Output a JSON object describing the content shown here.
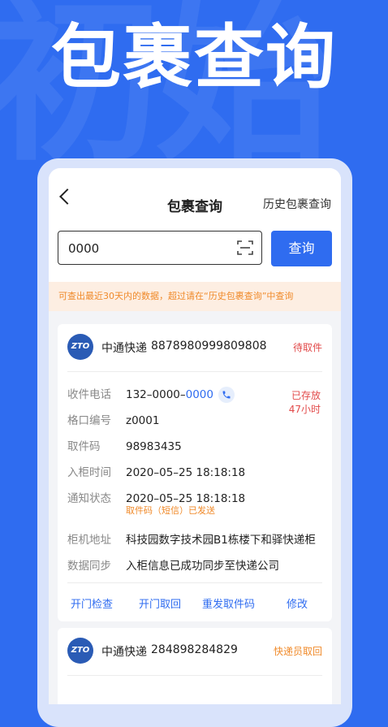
{
  "hero": {
    "watermark": "初始",
    "title": "包裹查询"
  },
  "nav": {
    "title": "包裹查询",
    "history": "历史包裹查询"
  },
  "search": {
    "value": "0000",
    "button": "查询"
  },
  "notice": "可查出最近30天内的数据，超过请在“历史包裹查询”中查询",
  "cards": [
    {
      "logo": "ZTO",
      "company": "中通快递",
      "tracking": "8878980999809808",
      "status": "待取件",
      "status_color": "#e24a4a",
      "stored_line1": "已存放",
      "stored_line2": "47小时",
      "rows": {
        "phone_label": "收件电话",
        "phone_prefix": "132–0000–",
        "phone_suffix": "0000",
        "slot_label": "格口编号",
        "slot_value": "z0001",
        "code_label": "取件码",
        "code_value": "98983435",
        "time_label": "入柜时间",
        "time_value": "2020–05–25 18:18:18",
        "notify_label": "通知状态",
        "notify_value": "2020–05–25 18:18:18",
        "notify_note": "取件码（短信）已发送",
        "address_label": "柜机地址",
        "address_value": "科技园数字技术园B1栋楼下和驿快递柜",
        "sync_label": "数据同步",
        "sync_value": "入柜信息已成功同步至快递公司"
      },
      "actions": [
        "开门检查",
        "开门取回",
        "重发取件码",
        "修改"
      ]
    },
    {
      "logo": "ZTO",
      "company": "中通快递",
      "tracking": "284898284829",
      "status": "快递员取回",
      "status_color": "#f08a2a"
    }
  ],
  "colors": {
    "accent": "#2f6cf0",
    "warning": "#f08a2a",
    "danger": "#e24a4a"
  }
}
